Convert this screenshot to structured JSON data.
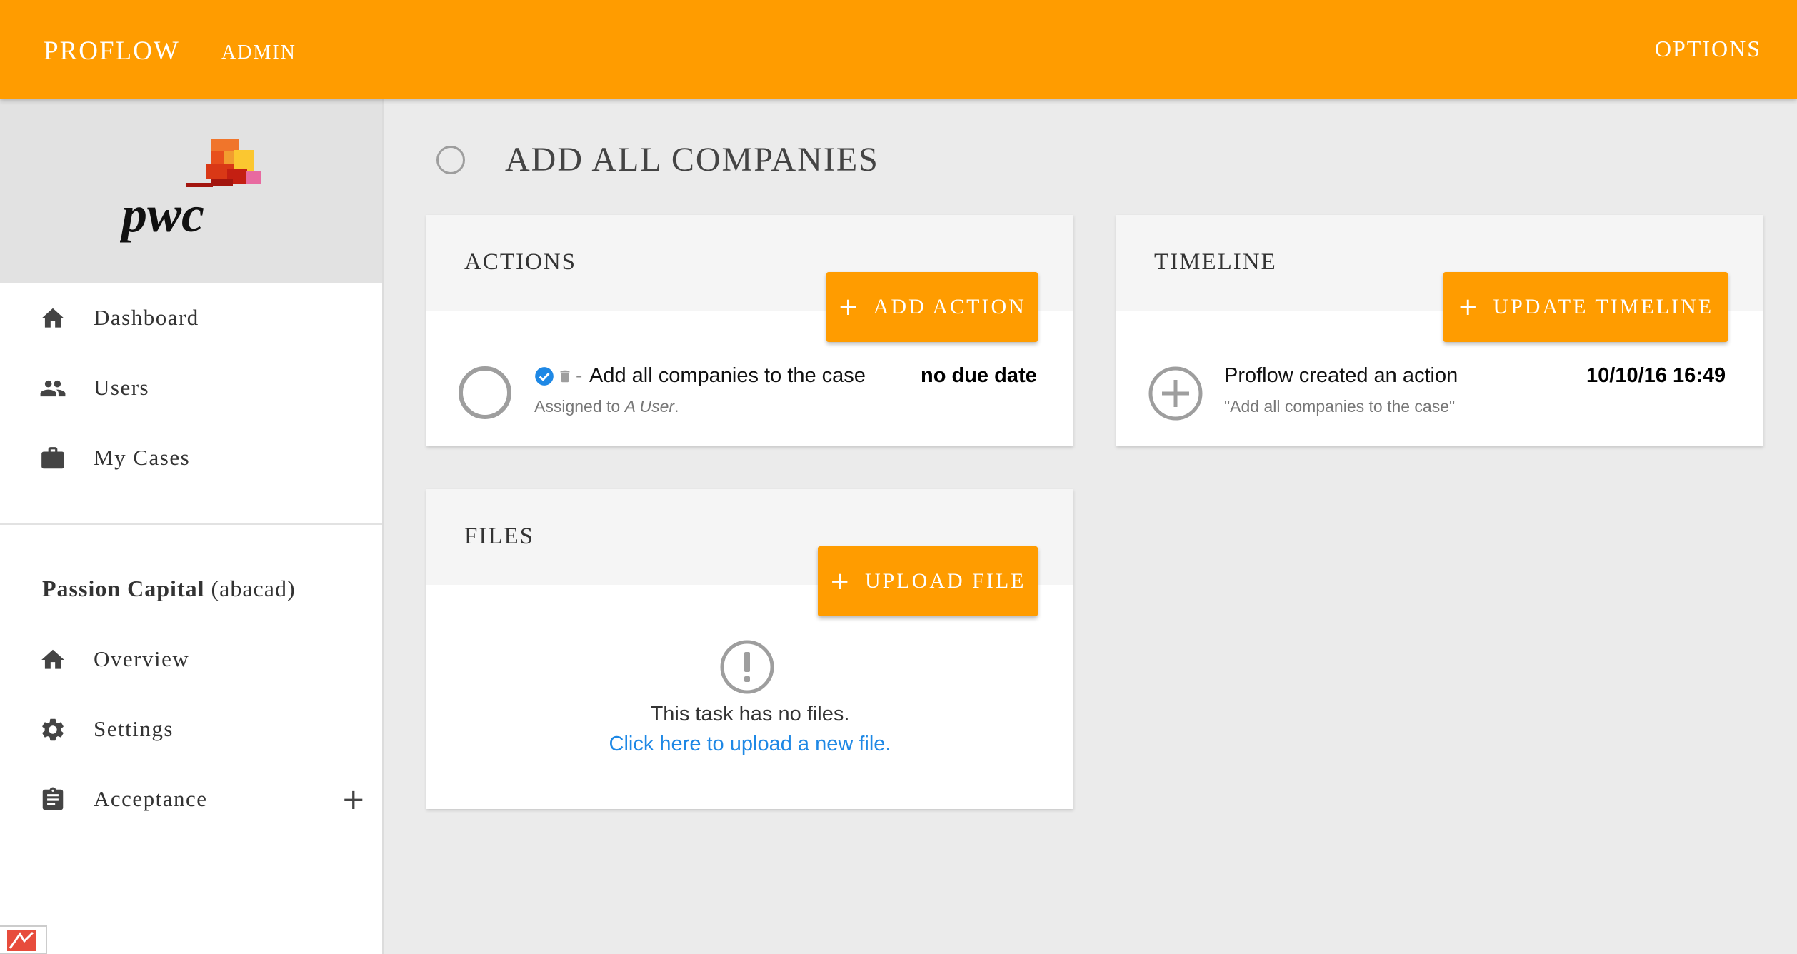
{
  "topbar": {
    "brand": "PROFLOW",
    "admin": "ADMIN",
    "options": "OPTIONS",
    "color": "#ff9c00"
  },
  "sidebar": {
    "logo_text": "pwc",
    "nav": [
      {
        "label": "Dashboard",
        "icon": "home-icon"
      },
      {
        "label": "Users",
        "icon": "users-icon"
      },
      {
        "label": "My Cases",
        "icon": "briefcase-icon"
      }
    ],
    "case": {
      "name": "Passion Capital",
      "code": "(abacad)"
    },
    "case_nav": [
      {
        "label": "Overview",
        "icon": "home-icon"
      },
      {
        "label": "Settings",
        "icon": "gear-icon"
      },
      {
        "label": "Acceptance",
        "icon": "clipboard-icon",
        "expand": "+"
      }
    ]
  },
  "main": {
    "task_title": "ADD ALL COMPANIES",
    "actions": {
      "title": "ACTIONS",
      "button": "ADD ACTION",
      "items": [
        {
          "dash": "-",
          "text": "Add all companies to the case",
          "due": "no due date",
          "assigned_prefix": "Assigned to",
          "assigned_user": "A User",
          "assigned_suffix": "."
        }
      ]
    },
    "timeline": {
      "title": "TIMELINE",
      "button": "UPDATE TIMELINE",
      "items": [
        {
          "text": "Proflow created an action",
          "date": "10/10/16 16:49",
          "sub": "\"Add all companies to the case\""
        }
      ]
    },
    "files": {
      "title": "FILES",
      "button": "UPLOAD FILE",
      "empty_text": "This task has no files.",
      "upload_link": "Click here to upload a new file."
    }
  }
}
